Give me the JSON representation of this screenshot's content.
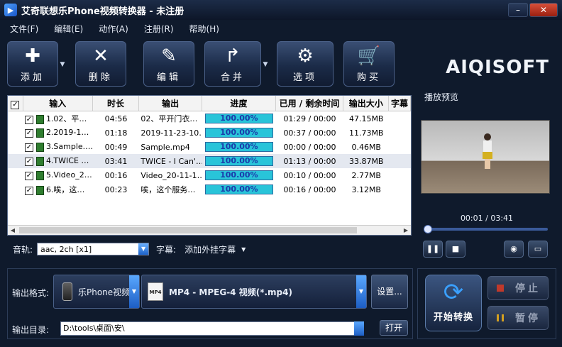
{
  "window": {
    "title": "艾奇联想乐Phone视频转换器 - 未注册",
    "app_icon": "film-icon",
    "minimize": "–",
    "close": "✕"
  },
  "menu": [
    "文件(F)",
    "编辑(E)",
    "动作(A)",
    "注册(R)",
    "帮助(H)"
  ],
  "toolbar": {
    "add": "添加",
    "delete": "删除",
    "edit": "编辑",
    "merge": "合并",
    "options": "选项",
    "buy": "购买"
  },
  "logo": "AIQISOFT",
  "table": {
    "headers": [
      "输入",
      "时长",
      "输出",
      "进度",
      "已用 / 剩余时间",
      "输出大小",
      "字幕"
    ],
    "rows": [
      {
        "input": "1.02、平…",
        "duration": "04:56",
        "output": "02、平开门衣…",
        "progress": "100.00%",
        "time": "01:29 / 00:00",
        "size": "47.15MB"
      },
      {
        "input": "2.2019-1…",
        "duration": "01:18",
        "output": "2019-11-23-10…",
        "progress": "100.00%",
        "time": "00:37 / 00:00",
        "size": "11.73MB"
      },
      {
        "input": "3.Sample.…",
        "duration": "00:49",
        "output": "Sample.mp4",
        "progress": "100.00%",
        "time": "00:00 / 00:00",
        "size": "0.46MB"
      },
      {
        "input": "4.TWICE …",
        "duration": "03:41",
        "output": "TWICE - I Can'…",
        "progress": "100.00%",
        "time": "01:13 / 00:00",
        "size": "33.87MB"
      },
      {
        "input": "5.Video_2…",
        "duration": "00:16",
        "output": "Video_20-11-1…",
        "progress": "100.00%",
        "time": "00:10 / 00:00",
        "size": "2.77MB"
      },
      {
        "input": "6.唉，这…",
        "duration": "00:23",
        "output": "唉，这个服务…",
        "progress": "100.00%",
        "time": "00:16 / 00:00",
        "size": "3.12MB"
      }
    ]
  },
  "audio": {
    "label": "音轨:",
    "value": "aac, 2ch [x1]",
    "subtitle_label": "字幕:",
    "subtitle_value": "添加外挂字幕"
  },
  "preview": {
    "title": "播放预览",
    "time": "00:01 / 03:41",
    "seek_fraction": 0.005
  },
  "output": {
    "format_label": "输出格式:",
    "device": "乐Phone视频",
    "format": "MP4 - MPEG-4 视频(*.mp4)",
    "settings": "设置...",
    "dir_label": "输出目录:",
    "dir_value": "D:\\tools\\桌面\\安\\",
    "open": "打开"
  },
  "actions": {
    "start": "开始转换",
    "stop": "停止",
    "pause": "暂停"
  },
  "colors": {
    "progress_fill": "#29c4d9",
    "progress_text": "#1a3aaa",
    "accent_blue": "#3aa0ff"
  }
}
